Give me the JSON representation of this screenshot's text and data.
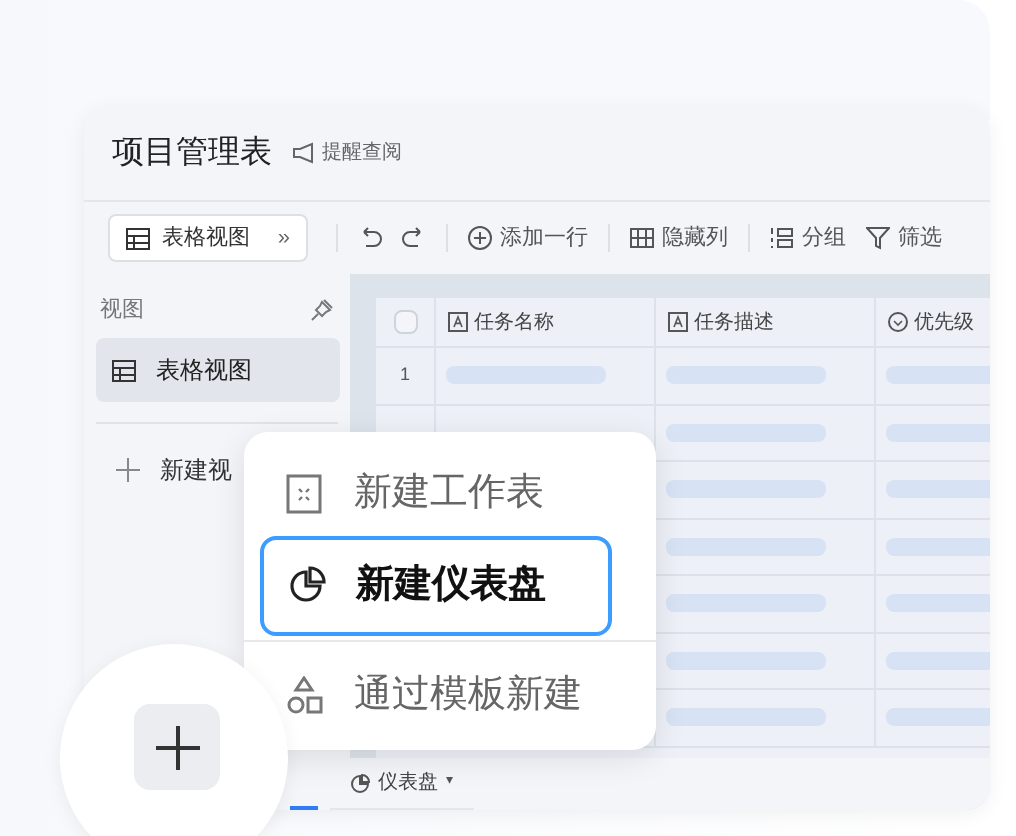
{
  "window": {
    "title": "项目管理表",
    "remind": "提醒查阅"
  },
  "toolbar": {
    "view_button": "表格视图",
    "expand": "»",
    "actions": [
      {
        "kind": "undo"
      },
      {
        "kind": "redo"
      },
      {
        "kind": "add",
        "label": "添加一行"
      },
      {
        "kind": "hide",
        "label": "隐藏列"
      },
      {
        "kind": "group",
        "label": "分组"
      },
      {
        "kind": "filter",
        "label": "筛选"
      }
    ]
  },
  "sidebar": {
    "heading": "视图",
    "items": [
      {
        "label": "表格视图",
        "selected": true
      }
    ],
    "new_view": "新建视"
  },
  "table": {
    "columns": [
      {
        "kind": "text",
        "label": "任务名称"
      },
      {
        "kind": "text",
        "label": "任务描述"
      },
      {
        "kind": "select",
        "label": "优先级"
      }
    ],
    "row_numbers": [
      "1"
    ],
    "select_all_checked": false
  },
  "sheet_tabs": [
    {
      "label": "仪表盘",
      "caret": "▾",
      "selected": false
    }
  ],
  "menu": [
    {
      "kind": "sheet",
      "label": "新建工作表",
      "selected": false
    },
    {
      "kind": "dashboard",
      "label": "新建仪表盘",
      "selected": true
    },
    {
      "kind": "template",
      "label": "通过模板新建",
      "selected": false
    }
  ]
}
